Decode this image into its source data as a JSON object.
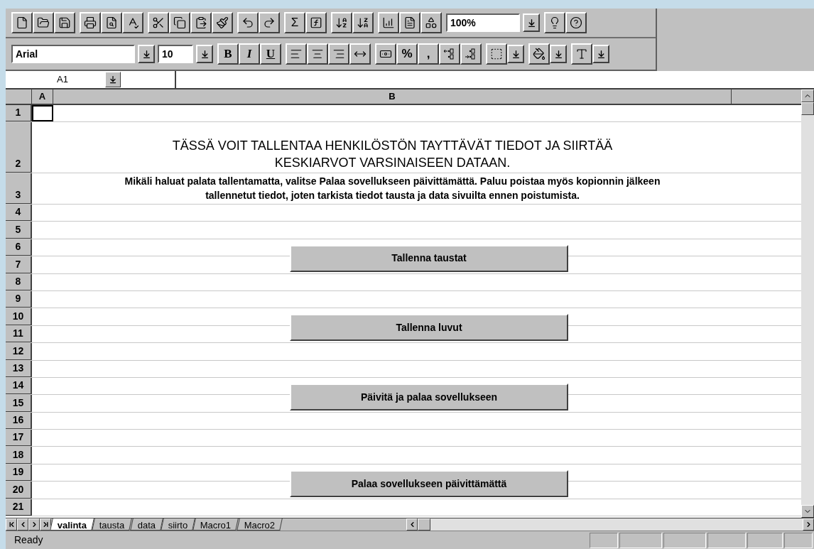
{
  "standard_toolbar": {
    "sum": "Σ",
    "zoom": "100%"
  },
  "formatting_toolbar": {
    "font": "Arial",
    "size": "10",
    "bold": "B",
    "italic": "I",
    "underline": "U",
    "percent": "%",
    "comma": ","
  },
  "name_box": "A1",
  "columns": [
    "A",
    "B"
  ],
  "rows": [
    {
      "number": "1"
    },
    {
      "number": "2",
      "text": "TÄSSÄ VOIT TALLENTAA HENKILÖSTÖN TAYTTÄVÄT TIEDOT JA SIIRTÄÄ KESKIARVOT VARSINAISEEN DATAAN.",
      "kind": "title"
    },
    {
      "number": "3",
      "text": "Mikäli haluat palata tallentamatta, valitse Palaa sovellukseen päivittämättä. Paluu poistaa myös kopionnin jälkeen tallennetut tiedot, joten tarkista tiedot tausta ja data sivuilta ennen poistumista.",
      "kind": "note"
    },
    {
      "number": "4"
    },
    {
      "number": "5"
    },
    {
      "number": "6"
    },
    {
      "number": "7"
    },
    {
      "number": "8"
    },
    {
      "number": "9"
    },
    {
      "number": "10"
    },
    {
      "number": "11"
    },
    {
      "number": "12"
    },
    {
      "number": "13"
    },
    {
      "number": "14"
    },
    {
      "number": "15"
    },
    {
      "number": "16"
    },
    {
      "number": "17"
    },
    {
      "number": "18"
    },
    {
      "number": "19"
    },
    {
      "number": "20"
    },
    {
      "number": "21"
    }
  ],
  "sheet_buttons": [
    {
      "label": "Tallenna taustat"
    },
    {
      "label": "Tallenna luvut"
    },
    {
      "label": "Päivitä ja palaa sovellukseen"
    },
    {
      "label": "Palaa sovellukseen päivittämättä"
    }
  ],
  "sheet_tabs": [
    {
      "label": "valinta",
      "selected": true
    },
    {
      "label": "tausta",
      "selected": false
    },
    {
      "label": "data",
      "selected": false
    },
    {
      "label": "siirto",
      "selected": false
    },
    {
      "label": "Macro1",
      "selected": false
    },
    {
      "label": "Macro2",
      "selected": false
    }
  ],
  "status_bar": {
    "text": "Ready"
  }
}
